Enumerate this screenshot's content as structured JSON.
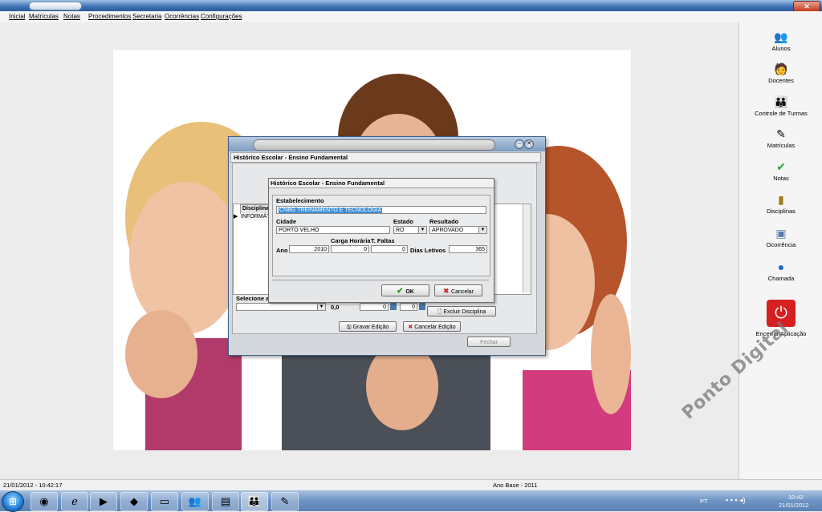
{
  "menu": {
    "items": [
      "Inicial",
      "Matrículas",
      "Notas",
      "Procedimentos",
      "Secretaria",
      "Ocorrências",
      "Configurações"
    ]
  },
  "right_panel": {
    "items": [
      {
        "label": "Alunos",
        "icon": "students-icon"
      },
      {
        "label": "Docentes",
        "icon": "teachers-icon"
      },
      {
        "label": "Controle de Turmas",
        "icon": "class-control-icon"
      },
      {
        "label": "Matrículas",
        "icon": "enrollment-icon"
      },
      {
        "label": "Notas",
        "icon": "grades-checkmark-icon"
      },
      {
        "label": "Disciplinas",
        "icon": "book-icon"
      },
      {
        "label": "Ocorrência",
        "icon": "occurrence-icon"
      },
      {
        "label": "Chamada",
        "icon": "attendance-icon"
      },
      {
        "label": "Encerrar Aplicação",
        "icon": "power-icon"
      }
    ]
  },
  "dialog": {
    "title": "Histórico Escolar - Ensino Fundamental",
    "grid": {
      "header": "Disciplina",
      "row_value": "INFORMÁTI"
    },
    "select_label": "Selecione a",
    "bottom_row": {
      "value1": "0,0",
      "value2": "0",
      "value3": "0"
    },
    "buttons": {
      "excluir": "Excluir Disciplina",
      "gravar": "Gravar Edição",
      "cancelar_edicao": "Cancelar Edição",
      "fechar": "Fechar"
    }
  },
  "subdialog": {
    "title": "Histórico Escolar - Ensino Fundamental",
    "labels": {
      "estabelecimento": "Estabelecimento",
      "cidade": "Cidade",
      "estado": "Estado",
      "resultado": "Resultado",
      "carga_horaria": "Carga Horária",
      "t_faltas": "T. Faltas",
      "ano": "Ano",
      "dias_letivos": "Dias Letivos"
    },
    "values": {
      "estabelecimento": "CNBG TREINAMENTO E TECNOLOGIA",
      "cidade": "PORTO VELHO",
      "estado": "RO",
      "resultado": "APROVADO",
      "ano": "2010",
      "carga_horaria": "0",
      "t_faltas": "0",
      "dias_letivos": "365"
    },
    "buttons": {
      "ok": "OK",
      "cancelar": "Cancelar"
    }
  },
  "status_bar": {
    "datetime": "21/01/2012 - 10:42:17",
    "ano_base": "Ano Base - 2011"
  },
  "taskbar": {
    "language": "PT",
    "time": "10:42",
    "date": "21/01/2012"
  },
  "watermark": "Ponto Digital",
  "colors": {
    "selection": "#3b8fd9",
    "power_button": "#d62020",
    "ok_check": "#1f9d1f",
    "cancel_x": "#c62020"
  }
}
